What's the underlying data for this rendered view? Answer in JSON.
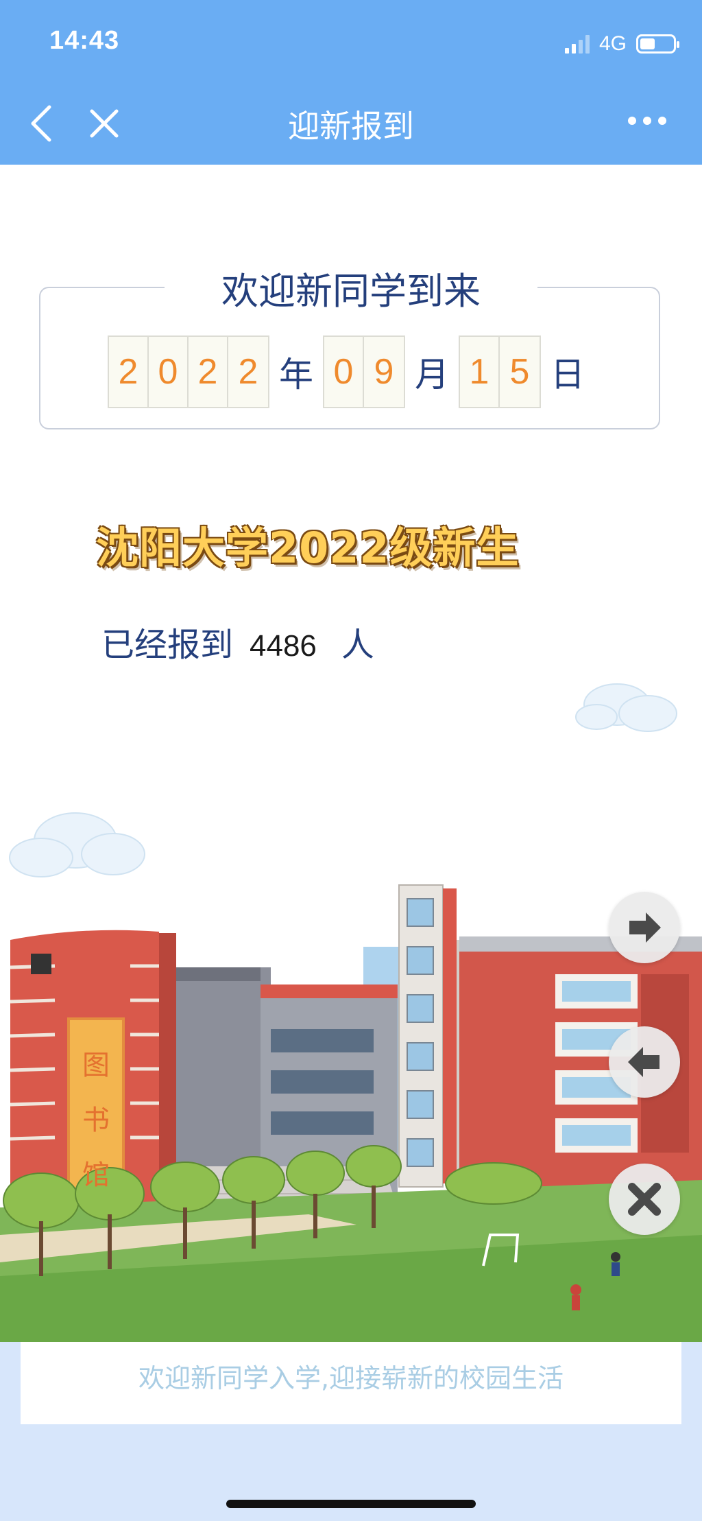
{
  "status_bar": {
    "time": "14:43",
    "network": "4G"
  },
  "nav": {
    "title": "迎新报到"
  },
  "welcome": {
    "title": "欢迎新同学到来",
    "year_digits": [
      "2",
      "0",
      "2",
      "2"
    ],
    "year_unit": "年",
    "month_digits": [
      "0",
      "9"
    ],
    "month_unit": "月",
    "day_digits": [
      "1",
      "5"
    ],
    "day_unit": "日"
  },
  "headline": "沈阳大学2022级新生",
  "registered": {
    "label": "已经报到",
    "count": "4486",
    "unit": "人"
  },
  "library_sign": [
    "图",
    "书",
    "馆"
  ],
  "caption": "欢迎新同学入学,迎接崭新的校园生活",
  "colors": {
    "nav_bg": "#6aadf3",
    "digit_color": "#ef8a2d",
    "text_blue": "#243f7c",
    "headline_gold": "#ffcf59"
  },
  "fab_icons": [
    "arrow-right-icon",
    "arrow-left-icon",
    "close-x-icon"
  ]
}
